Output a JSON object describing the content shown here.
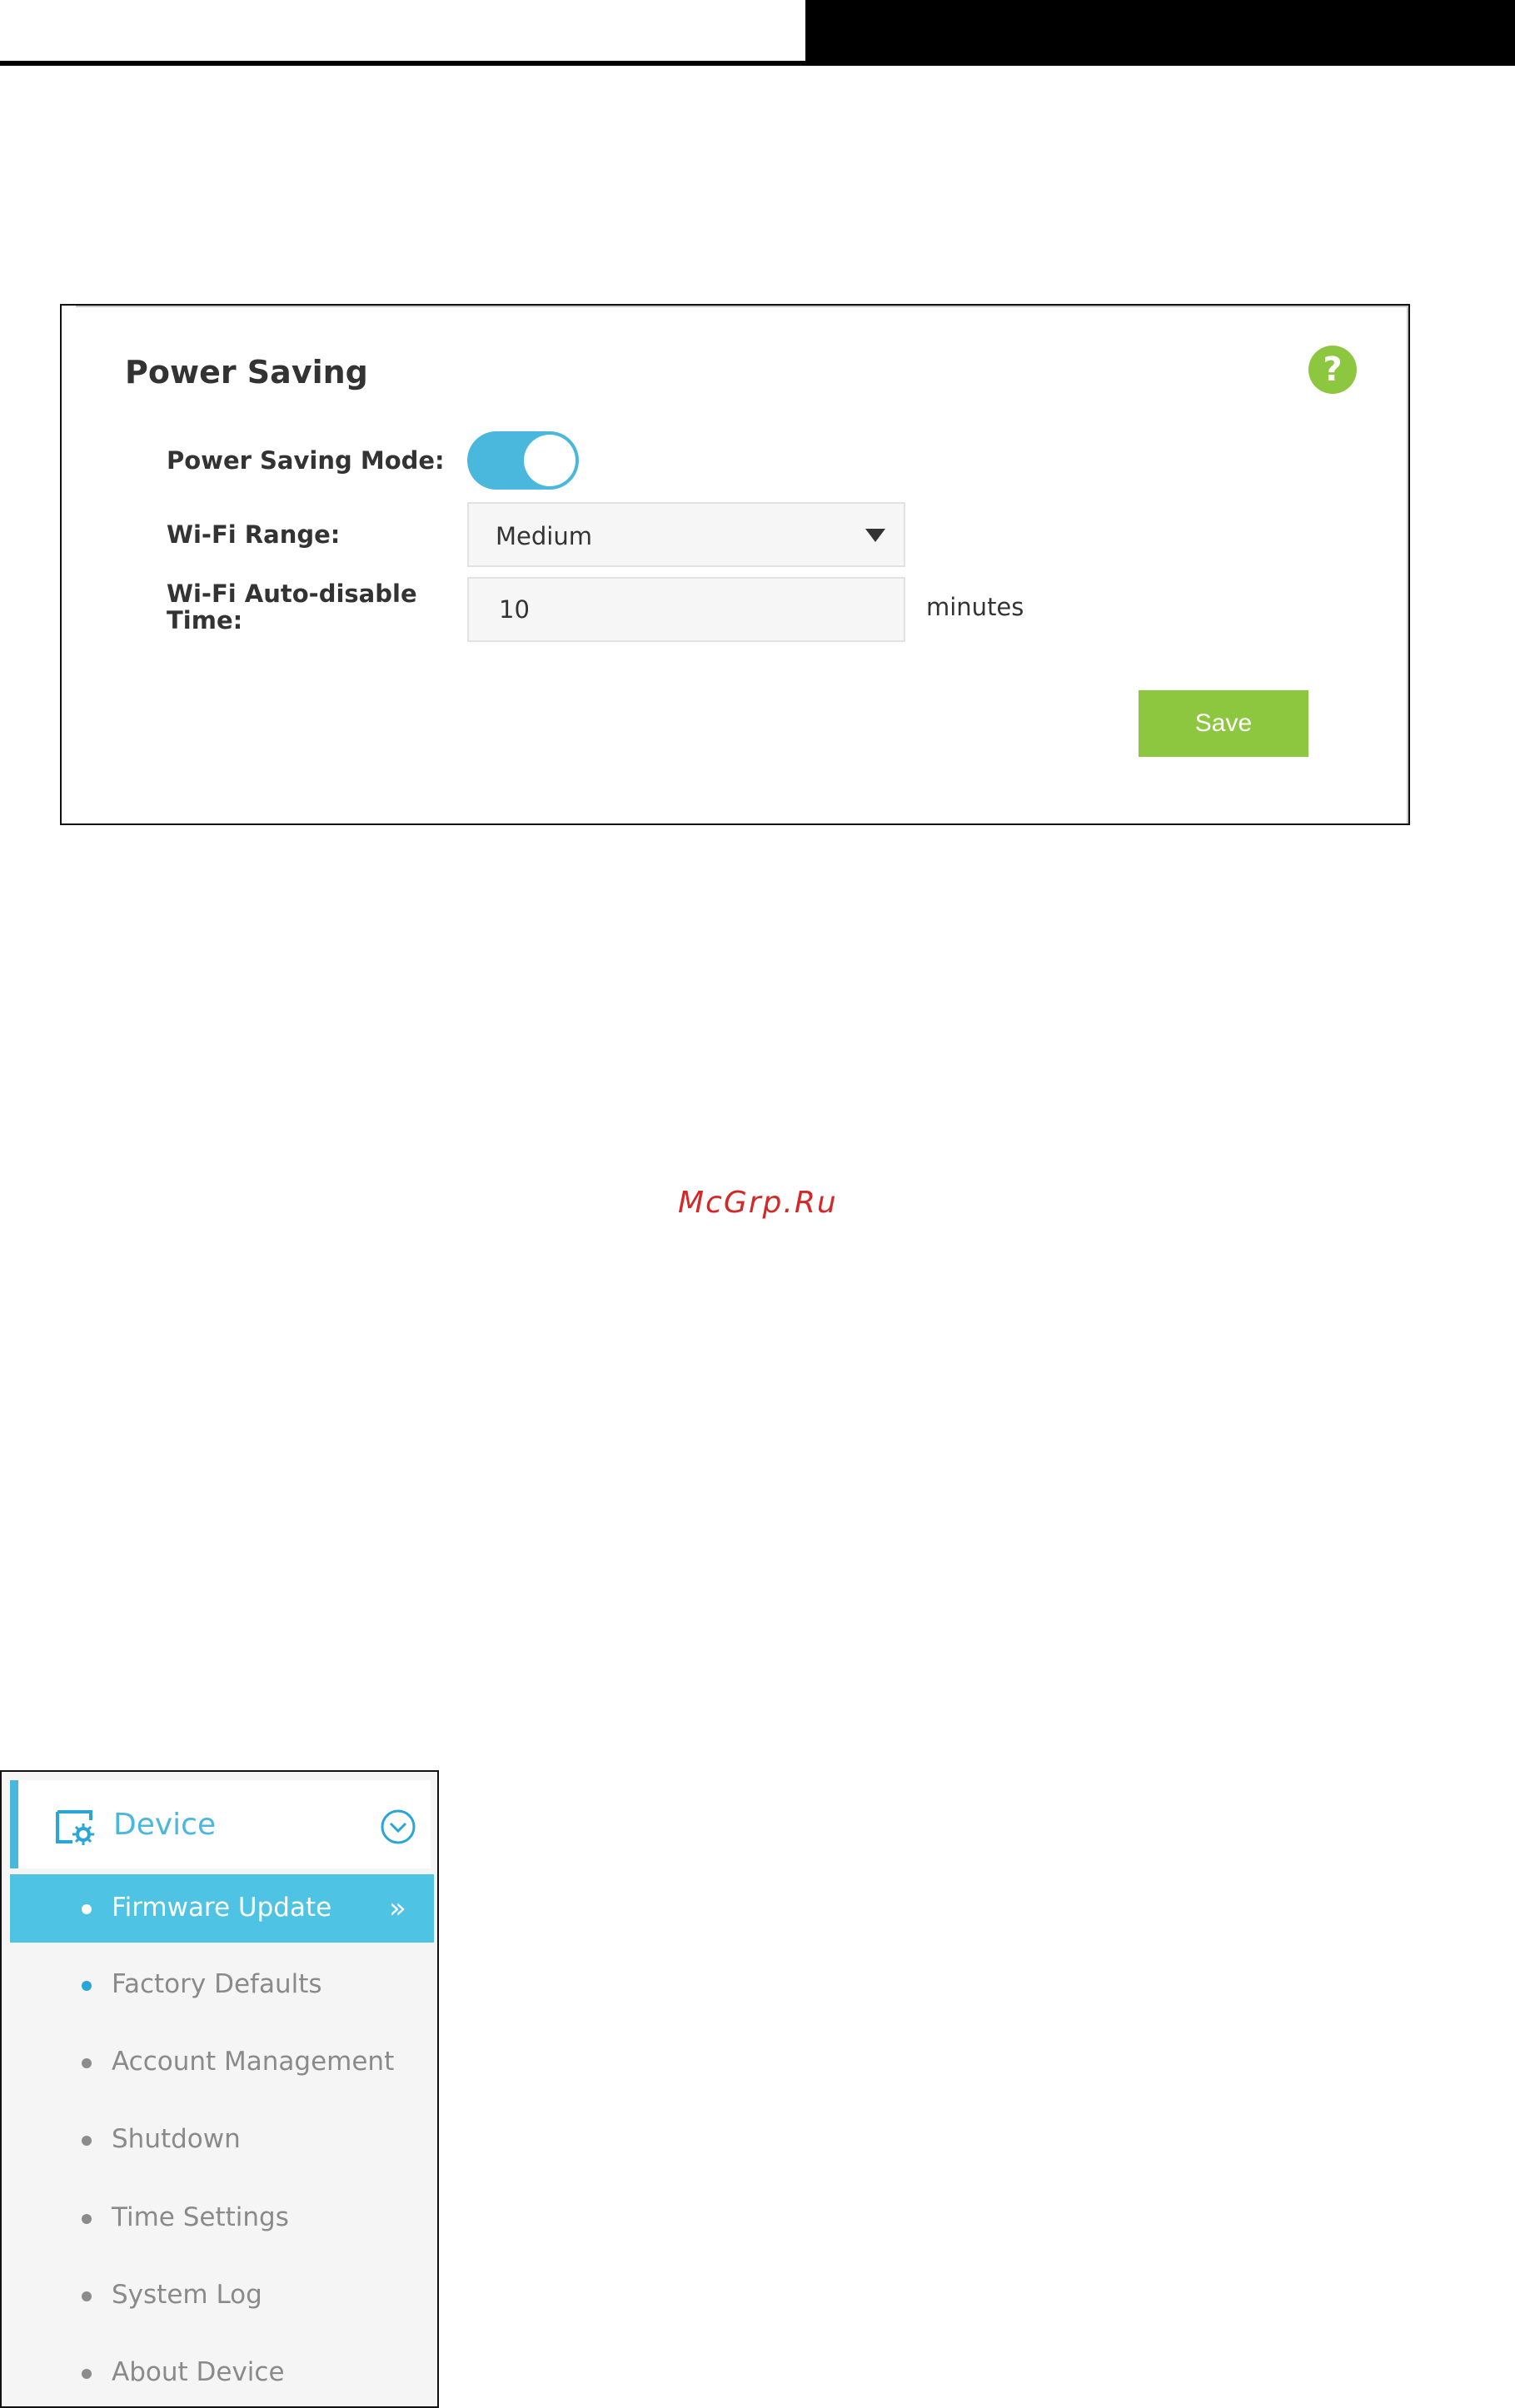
{
  "power_saving": {
    "title": "Power Saving",
    "help_icon": "?",
    "mode_label": "Power Saving Mode:",
    "mode_enabled": true,
    "range_label": "Wi-Fi Range:",
    "range_value": "Medium",
    "time_label": "Wi-Fi Auto-disable Time:",
    "time_value": "10",
    "time_unit": "minutes",
    "save_label": "Save"
  },
  "watermark": "McGrp.Ru",
  "menu": {
    "header_label": "Device",
    "items": [
      {
        "label": "Firmware Update",
        "active": true
      },
      {
        "label": "Factory Defaults",
        "active": false
      },
      {
        "label": "Account Management",
        "active": false
      },
      {
        "label": "Shutdown",
        "active": false
      },
      {
        "label": "Time Settings",
        "active": false
      },
      {
        "label": "System Log",
        "active": false
      },
      {
        "label": "About Device",
        "active": false
      }
    ]
  },
  "colors": {
    "accent_blue": "#4ab7dd",
    "active_row": "#4fc3e3",
    "save_green": "#8dc63f",
    "watermark_red": "#d42727"
  }
}
